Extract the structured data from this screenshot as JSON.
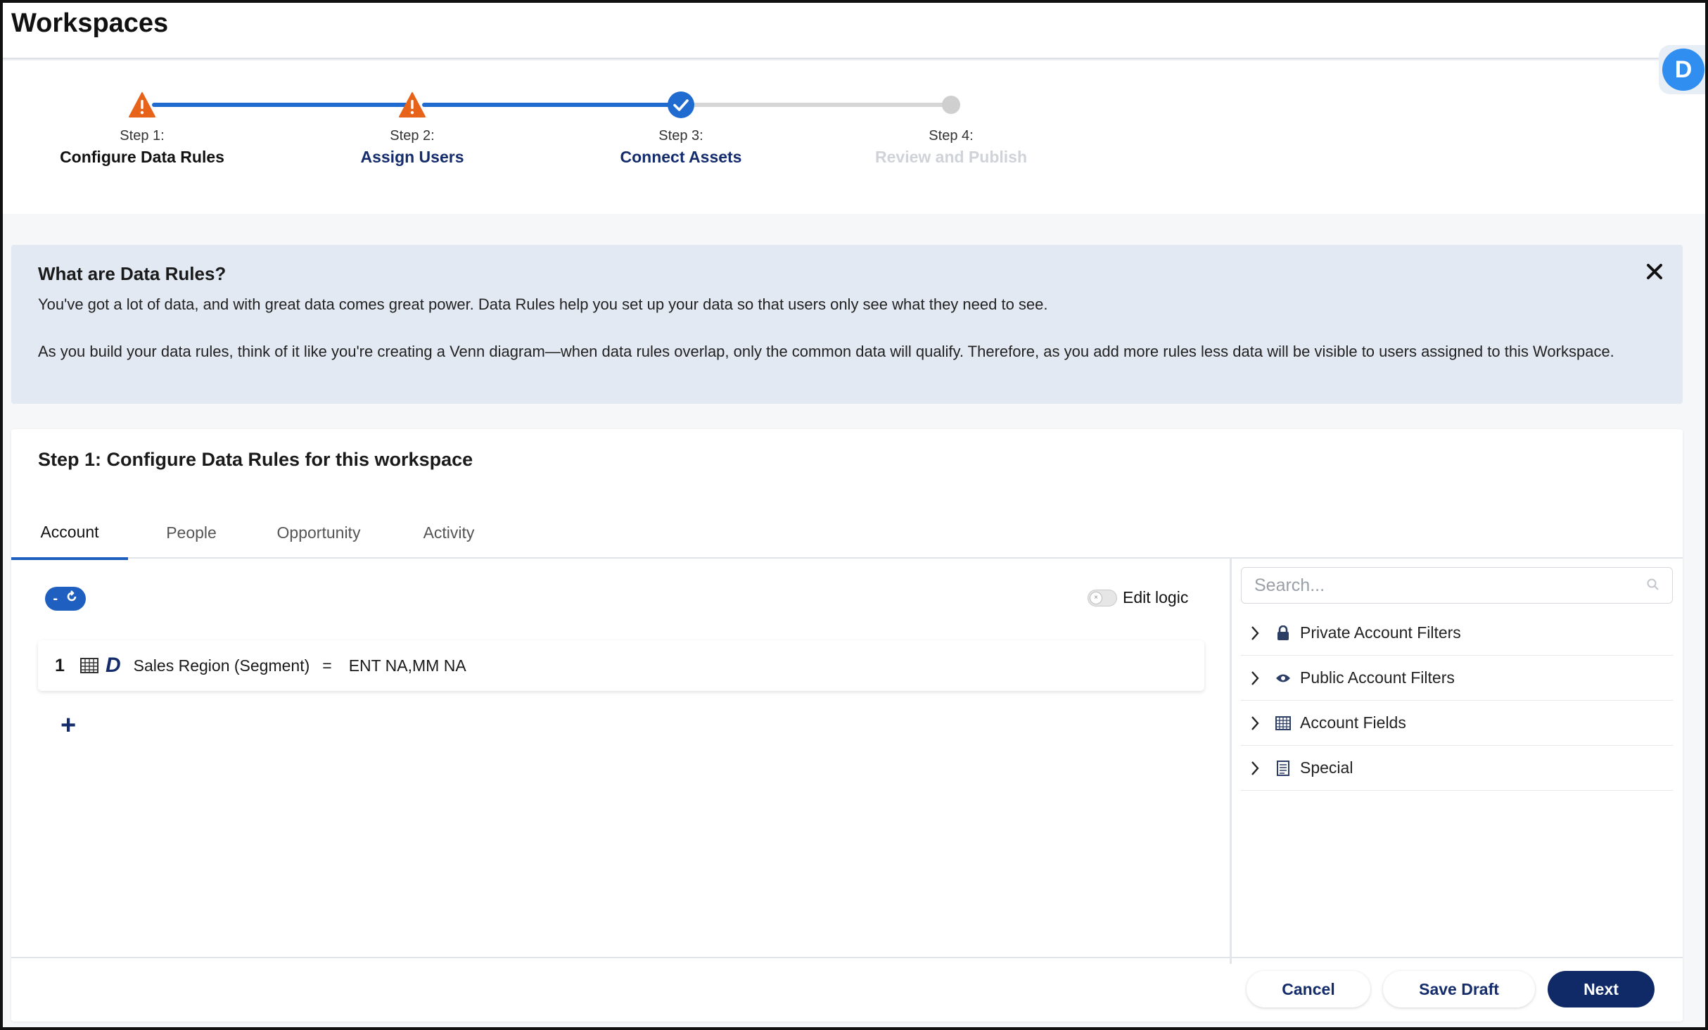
{
  "app": {
    "title": "Workspaces"
  },
  "stepper": {
    "steps": [
      {
        "num": "Step 1:",
        "title": "Configure Data Rules",
        "status": "warning",
        "title_color": "#111111"
      },
      {
        "num": "Step 2:",
        "title": "Assign Users",
        "status": "warning",
        "title_color": "#142c6b"
      },
      {
        "num": "Step 3:",
        "title": "Connect Assets",
        "status": "complete",
        "title_color": "#142c6b"
      },
      {
        "num": "Step 4:",
        "title": "Review and Publish",
        "status": "pending",
        "title_color": "#cfd3d8"
      }
    ],
    "colors": {
      "active_line": "#1f6bd0",
      "inactive_line": "#d6d6d6",
      "warning": "#e8631a",
      "complete": "#1f6bd0",
      "pending": "#cfcfcf"
    }
  },
  "avatar": {
    "letter": "D"
  },
  "banner": {
    "title": "What are Data Rules?",
    "p1": "You've got a lot of data, and with great data comes great power. Data Rules help you set up your data so that users only see what they need to see.",
    "p2": "As you build your data rules, think of it like you're creating a Venn diagram—when data rules overlap, only the common data will qualify. Therefore, as you add more rules less data will be visible to users assigned to this Workspace.",
    "close": "✕"
  },
  "card": {
    "title": "Step 1: Configure Data Rules for this workspace",
    "tabs": [
      {
        "label": "Account",
        "active": true
      },
      {
        "label": "People",
        "active": false
      },
      {
        "label": "Opportunity",
        "active": false
      },
      {
        "label": "Activity",
        "active": false
      }
    ],
    "logic_toggle": {
      "left": "-",
      "right": "↻"
    },
    "edit_logic": "Edit logic",
    "rules": [
      {
        "num": "1",
        "source_letter": "D",
        "field": "Sales Region (Segment)",
        "op": "=",
        "value": "ENT NA,MM NA"
      }
    ],
    "add_symbol": "+",
    "search": {
      "placeholder": "Search..."
    },
    "filters": [
      {
        "label": "Private Account Filters",
        "icon": "lock-icon"
      },
      {
        "label": "Public Account Filters",
        "icon": "eye-icon"
      },
      {
        "label": "Account Fields",
        "icon": "table-icon"
      },
      {
        "label": "Special",
        "icon": "list-icon"
      }
    ]
  },
  "footer": {
    "cancel": "Cancel",
    "save_draft": "Save Draft",
    "next": "Next"
  }
}
